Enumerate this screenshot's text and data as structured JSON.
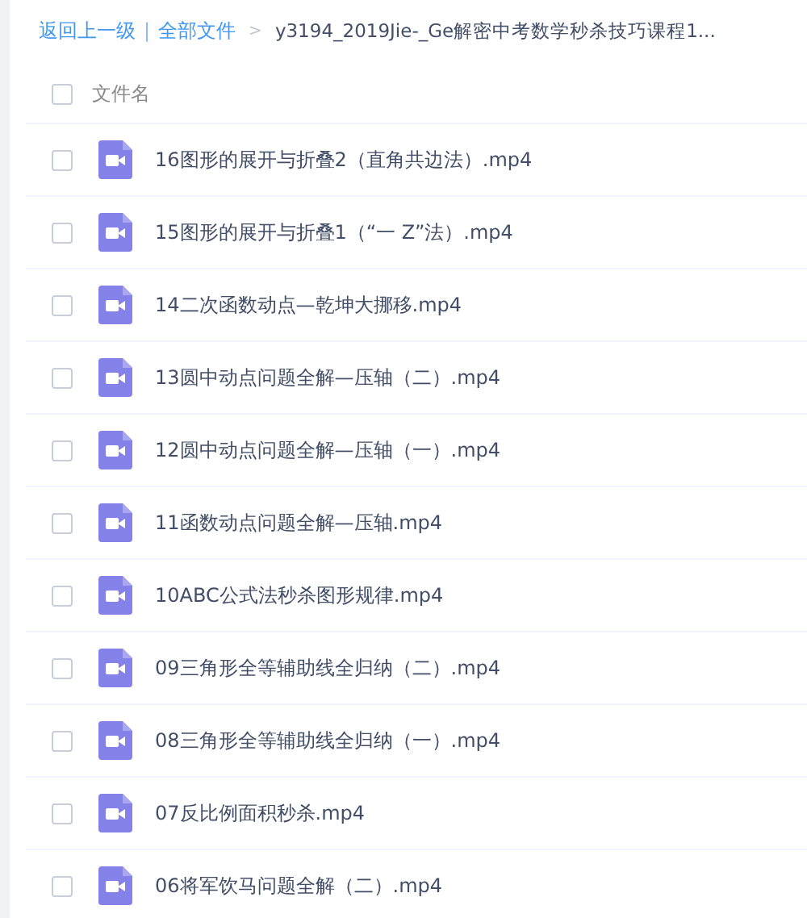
{
  "breadcrumb": {
    "back": "返回上一级",
    "separator": "|",
    "root": "全部文件",
    "arrow": ">",
    "current": "y3194_2019Jie-_Ge解密中考数学秒杀技巧课程1..."
  },
  "table": {
    "header": {
      "label": "文件名",
      "checked": false
    },
    "rows": [
      {
        "name": "16图形的展开与折叠2（直角共边法）.mp4",
        "checked": false
      },
      {
        "name": "15图形的展开与折叠1（“一 Z”法）.mp4",
        "checked": false
      },
      {
        "name": "14二次函数动点—乾坤大挪移.mp4",
        "checked": false
      },
      {
        "name": "13圆中动点问题全解—压轴（二）.mp4",
        "checked": false
      },
      {
        "name": "12圆中动点问题全解—压轴（一）.mp4",
        "checked": false
      },
      {
        "name": "11函数动点问题全解—压轴.mp4",
        "checked": false
      },
      {
        "name": "10ABC公式法秒杀图形规律.mp4",
        "checked": false
      },
      {
        "name": "09三角形全等辅助线全归纳（二）.mp4",
        "checked": false
      },
      {
        "name": "08三角形全等辅助线全归纳（一）.mp4",
        "checked": false
      },
      {
        "name": "07反比例面积秒杀.mp4",
        "checked": false
      },
      {
        "name": "06将军饮马问题全解（二）.mp4",
        "checked": false
      }
    ]
  }
}
